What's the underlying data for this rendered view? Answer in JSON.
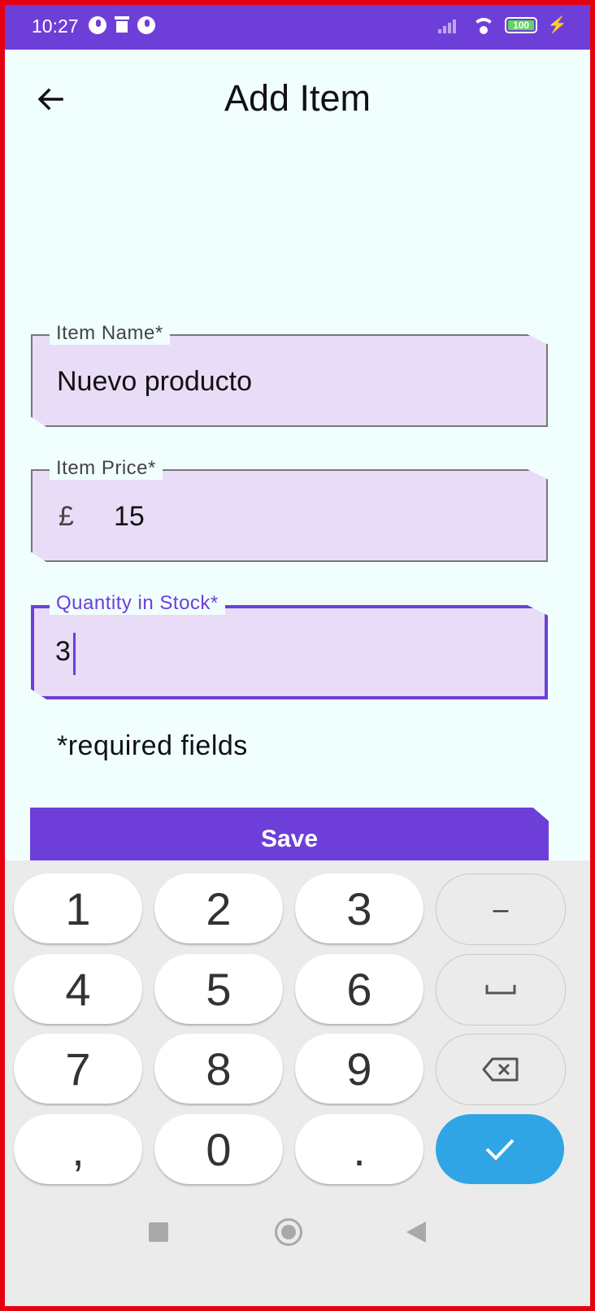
{
  "status_bar": {
    "time": "10:27",
    "battery": "100",
    "icons": [
      "notification-icon",
      "trash-icon",
      "notification-icon",
      "signal-off-icon",
      "wifi-icon",
      "battery-icon",
      "charging-icon"
    ]
  },
  "header": {
    "title": "Add Item",
    "back_icon": "arrow-left-icon"
  },
  "form": {
    "name_label": "Item Name*",
    "name_value": "Nuevo producto",
    "price_label": "Item Price*",
    "price_currency": "£",
    "price_value": "15",
    "quantity_label": "Quantity in Stock*",
    "quantity_value": "3",
    "required_note": "*required fields",
    "save_label": "Save"
  },
  "keyboard": {
    "rows": [
      [
        "1",
        "2",
        "3",
        "–"
      ],
      [
        "4",
        "5",
        "6",
        "space"
      ],
      [
        "7",
        "8",
        "9",
        "backspace"
      ],
      [
        ",",
        "0",
        ".",
        "done"
      ]
    ],
    "keys": {
      "k1": "1",
      "k2": "2",
      "k3": "3",
      "minus": "–",
      "k4": "4",
      "k5": "5",
      "k6": "6",
      "k7": "7",
      "k8": "8",
      "k9": "9",
      "comma": ",",
      "k0": "0",
      "period": "."
    }
  },
  "colors": {
    "accent": "#6e3fd8",
    "field_fill": "#e8dcf6",
    "background": "#f0fffe",
    "done_key": "#2fa5e6"
  }
}
